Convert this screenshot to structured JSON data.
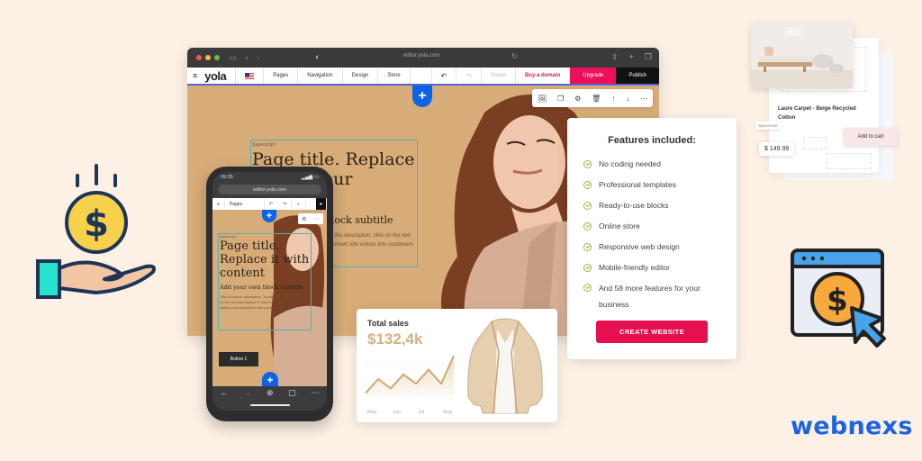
{
  "desktop_browser": {
    "url": "editor.yola.com",
    "editor_bar": {
      "logo": "yola",
      "tabs": [
        "Pages",
        "Navigation",
        "Design",
        "Store"
      ],
      "saved_label": "Saved",
      "buy_domain_label": "Buy a domain",
      "upgrade_label": "Upgrade",
      "publish_label": "Publish"
    },
    "add_block_label": "+",
    "block_toolbar_icons": [
      "image-icon",
      "duplicate-icon",
      "gear-icon",
      "trash-icon",
      "arrow-up-icon",
      "arrow-down-icon",
      "more-icon"
    ],
    "text_block": {
      "superscript": "Superscript",
      "title": "Page title. Replace it with your content",
      "subtitle": "Add your own block subtitle",
      "description": "This is a block description. To edit this description, click on the text and replace it. Use this space to convert site visitors into customers with a promotion."
    }
  },
  "phone": {
    "time": "09:35",
    "url": "editor.yola.com",
    "toolbar_label": "Pages",
    "text_block": {
      "superscript": "Superscript",
      "title_lines": [
        "Page title.",
        "Replace it with",
        "content"
      ],
      "subtitle": "Add your own block subtitle",
      "description": "This is a block description. To edit this description, click on the text and replace it. Use this space to convert site visitors into customers with a promotion."
    },
    "button_label": "Button 1",
    "plus_label": "+"
  },
  "features_card": {
    "title": "Features included:",
    "items": [
      "No coding needed",
      "Professional templates",
      "Ready-to-use blocks",
      "Online store",
      "Responsive web design",
      "Mobile-friendly editor",
      "And 58 more features for your business"
    ],
    "cta_label": "CREATE WEBSITE",
    "accent": "#e5104f",
    "check_color": "#9bb73a"
  },
  "sales_card": {
    "label": "Total sales",
    "value": "$132,4k",
    "chart_data": {
      "type": "area",
      "categories": [
        "May",
        "Jun",
        "Jul",
        "Aug"
      ],
      "values": [
        2,
        5,
        3,
        6,
        4,
        7,
        4,
        10
      ],
      "x_points": [
        0,
        0.5,
        1,
        1.5,
        2,
        2.5,
        3,
        3.5
      ],
      "ylim": [
        0,
        10
      ],
      "title": "Total sales",
      "color": "#d8b07e"
    }
  },
  "product_card": {
    "title": "Laure Carpet - Beige Recycled Cotton",
    "sponsored_label": "Sponsored",
    "price": "$ 149.99",
    "add_to_cart_label": "Add to cart"
  },
  "brand": {
    "name": "webnexs",
    "color": "#1e63e0"
  }
}
